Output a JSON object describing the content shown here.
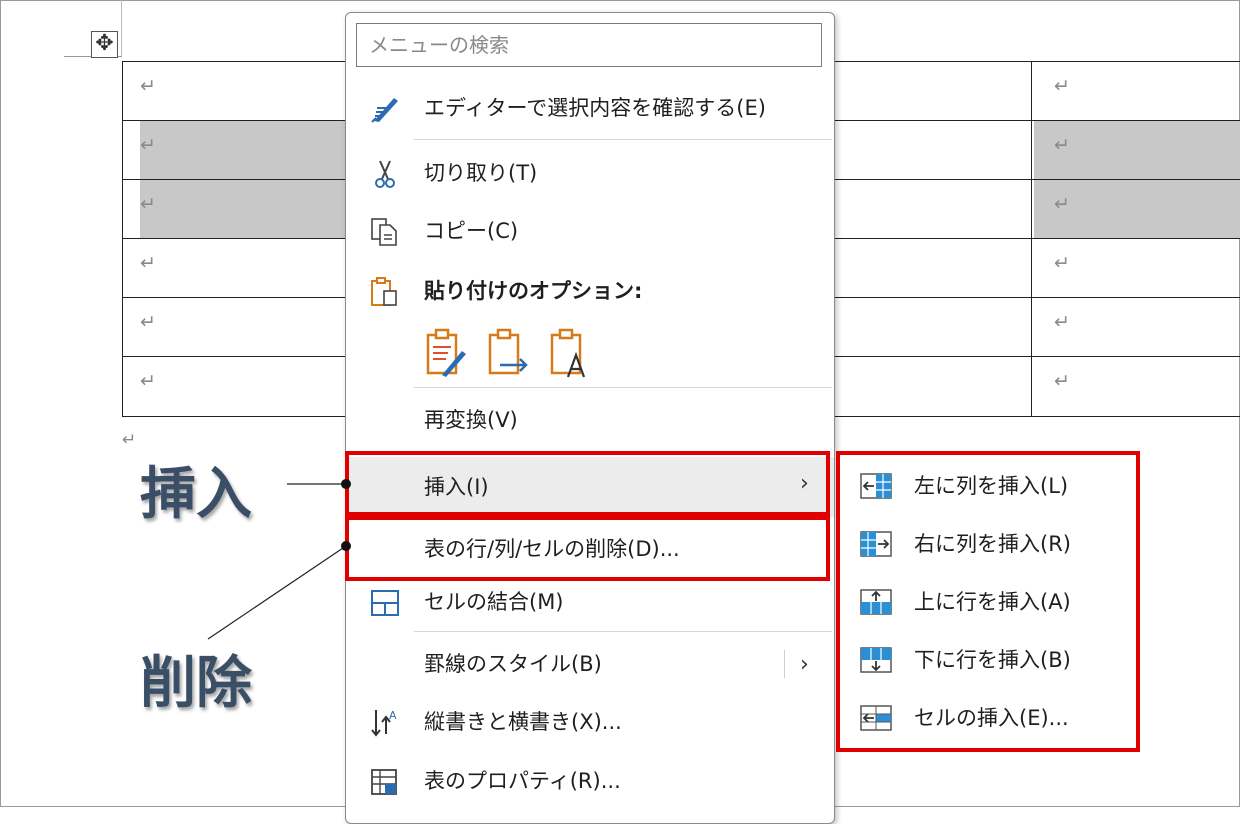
{
  "table": {
    "return_mark": "↵",
    "rows": 6,
    "selected_rows": [
      1,
      2
    ]
  },
  "callouts": {
    "insert": "挿入",
    "delete": "削除"
  },
  "context_menu": {
    "search_placeholder": "メニューの検索",
    "items": [
      {
        "label": "エディターで選択内容を確認する(E)",
        "icon": "editor-pen-icon"
      },
      {
        "label": "切り取り(T)",
        "icon": "scissors-icon"
      },
      {
        "label": "コピー(C)",
        "icon": "copy-icon"
      },
      {
        "label": "貼り付けのオプション:",
        "icon": "paste-icon"
      },
      {
        "label": "再変換(V)"
      },
      {
        "label": "挿入(I)",
        "has_submenu": true
      },
      {
        "label": "表の行/列/セルの削除(D)..."
      },
      {
        "label": "セルの結合(M)",
        "icon": "merge-cells-icon"
      },
      {
        "label": "罫線のスタイル(B)",
        "has_submenu": true
      },
      {
        "label": "縦書きと横書き(X)...",
        "icon": "text-direction-icon"
      },
      {
        "label": "表のプロパティ(R)...",
        "icon": "table-properties-icon"
      }
    ],
    "paste_options": [
      "keep-source-formatting-icon",
      "merge-formatting-icon",
      "keep-text-only-icon"
    ]
  },
  "insert_submenu": {
    "items": [
      {
        "label": "左に列を挿入(L)",
        "icon": "insert-column-left-icon"
      },
      {
        "label": "右に列を挿入(R)",
        "icon": "insert-column-right-icon"
      },
      {
        "label": "上に行を挿入(A)",
        "icon": "insert-row-above-icon"
      },
      {
        "label": "下に行を挿入(B)",
        "icon": "insert-row-below-icon"
      },
      {
        "label": "セルの挿入(E)...",
        "icon": "insert-cells-icon"
      }
    ]
  },
  "colors": {
    "highlight_red": "#e00000",
    "selected_cell": "#c8c8c8",
    "callout_text": "#3a4e66",
    "icon_blue": "#2b6cb0",
    "icon_orange": "#d77b18"
  }
}
